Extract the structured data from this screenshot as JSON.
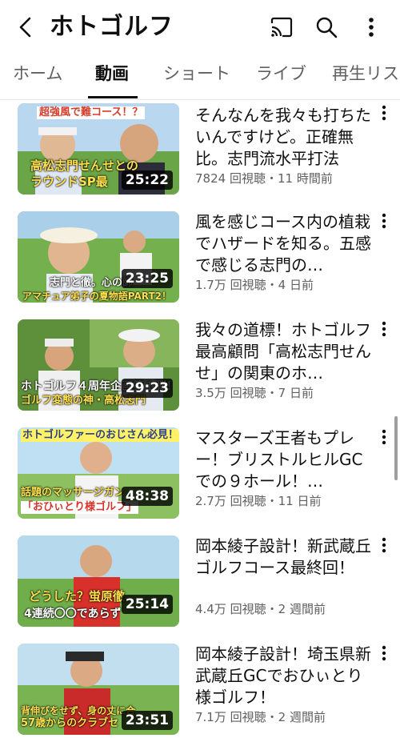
{
  "header": {
    "title": "ホトゴルフ",
    "icons": [
      "back-arrow-icon",
      "cast-icon",
      "search-icon",
      "more-vert-icon"
    ]
  },
  "tabs": [
    {
      "label": "ホーム",
      "active": false
    },
    {
      "label": "動画",
      "active": true
    },
    {
      "label": "ショート",
      "active": false
    },
    {
      "label": "ライブ",
      "active": false
    },
    {
      "label": "再生リス",
      "active": false
    }
  ],
  "videos": [
    {
      "title": "そんなんを我々も打ちたいんですけど。正確無比。志門流水平打法",
      "views": "7824 回視聴",
      "age": "11 時間前",
      "duration": "25:22",
      "captions": [
        "超強風で難コース！？",
        "高松志門せんせとの",
        "ラウンドSP最"
      ]
    },
    {
      "title": "風を感じコース内の植栽でハザードを知る。五感で感じる志門の…",
      "views": "1.7万 回視聴",
      "age": "4 日前",
      "duration": "23:25",
      "captions": [
        "志門と徹。心の師",
        "アマチュア弟子の夏物語PART2！"
      ]
    },
    {
      "title": "我々の道標！ホトゴルフ最高顧問「高松志門せんせ」の関東のホ…",
      "views": "3.5万 回視聴",
      "age": "7 日前",
      "duration": "29:23",
      "captions": [
        "ホトゴルフ４周年企画第１弾！",
        "ゴルフ変態の神・高松志門"
      ]
    },
    {
      "title": "マスターズ王者もプレー！ブリストルヒルGCでの９ホール！…",
      "views": "2.7万 回視聴",
      "age": "11 日前",
      "duration": "48:38",
      "captions": [
        "ホトゴルファーのおじさん必見！",
        "話題のマッサージガン",
        "「おひぃとり様ゴルフ」"
      ]
    },
    {
      "title": "岡本綾子設計！新武蔵丘ゴルフコース最終回！",
      "views": "4.4万 回視聴",
      "age": "2 週間前",
      "duration": "25:14",
      "captions": [
        "どうした？蛍原徹",
        "4連続〇〇であらず"
      ]
    },
    {
      "title": "岡本綾子設計！埼玉県新武蔵丘GCでおひぃとり様ゴルフ！",
      "views": "7.1万 回視聴",
      "age": "2 週間前",
      "duration": "23:51",
      "captions": [
        "背伸びをせず、身の丈に合",
        "57歳からのクラブセ"
      ]
    }
  ],
  "meta_separator": "・",
  "colors": {
    "thumb_border": "#7ec850",
    "accent_text": "#0f0f0f",
    "meta_text": "#606060"
  }
}
